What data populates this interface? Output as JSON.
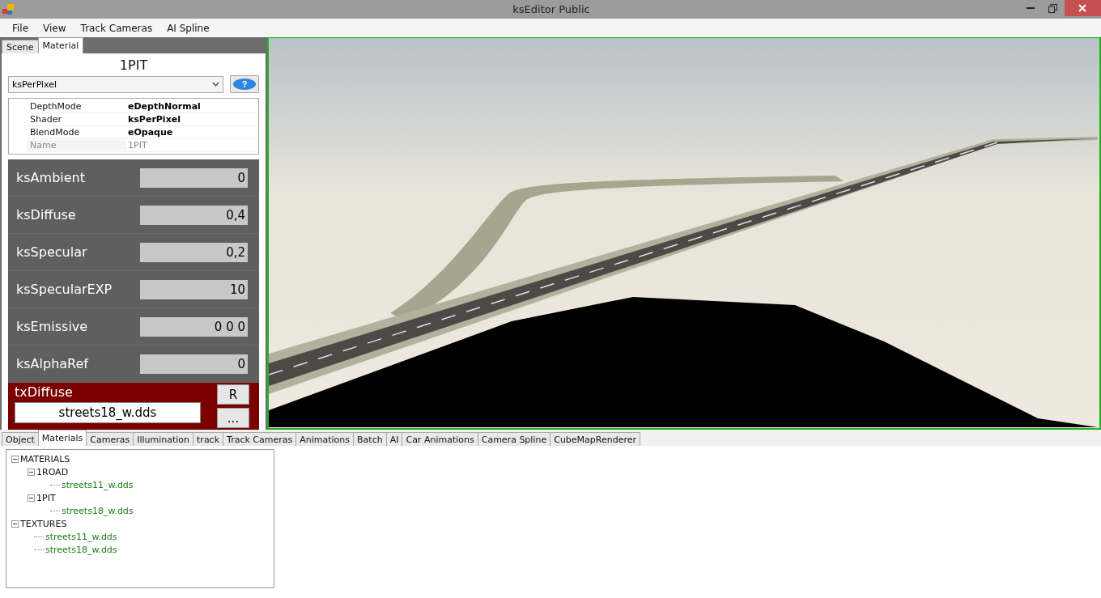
{
  "window": {
    "title": "ksEditor Public"
  },
  "menu": [
    "File",
    "View",
    "Track Cameras",
    "AI Spline"
  ],
  "top_tabs": [
    {
      "label": "Scene",
      "selected": false
    },
    {
      "label": "Material",
      "selected": true
    }
  ],
  "material": {
    "name": "1PIT",
    "shader_select": "ksPerPixel",
    "help_button": "?",
    "properties": [
      {
        "key": "DepthMode",
        "value": "eDepthNormal",
        "disabled": false
      },
      {
        "key": "Shader",
        "value": "ksPerPixel",
        "disabled": false
      },
      {
        "key": "BlendMode",
        "value": "eOpaque",
        "disabled": false
      },
      {
        "key": "Name",
        "value": "1PIT",
        "disabled": true
      }
    ],
    "parameters": [
      {
        "name": "ksAmbient",
        "value": "0"
      },
      {
        "name": "ksDiffuse",
        "value": "0,4"
      },
      {
        "name": "ksSpecular",
        "value": "0,2"
      },
      {
        "name": "ksSpecularEXP",
        "value": "10"
      },
      {
        "name": "ksEmissive",
        "value": "0 0 0"
      },
      {
        "name": "ksAlphaRef",
        "value": "0"
      }
    ],
    "texture": {
      "slot": "txDiffuse",
      "file": "streets18_w.dds",
      "buttons": [
        "R",
        "..."
      ]
    }
  },
  "bottom_tabs": [
    {
      "label": "Object",
      "selected": false
    },
    {
      "label": "Materials",
      "selected": true
    },
    {
      "label": "Cameras",
      "selected": false
    },
    {
      "label": "Illumination",
      "selected": false
    },
    {
      "label": "track",
      "selected": false
    },
    {
      "label": "Track Cameras",
      "selected": false
    },
    {
      "label": "Animations",
      "selected": false
    },
    {
      "label": "Batch",
      "selected": false
    },
    {
      "label": "AI",
      "selected": false
    },
    {
      "label": "Car Animations",
      "selected": false
    },
    {
      "label": "Camera Spline",
      "selected": false
    },
    {
      "label": "CubeMapRenderer",
      "selected": false
    }
  ],
  "tree": [
    {
      "label": "MATERIALS",
      "expanded": true,
      "children": [
        {
          "label": "1ROAD",
          "expanded": true,
          "children": [
            {
              "label": "streets11_w.dds"
            }
          ]
        },
        {
          "label": "1PIT",
          "expanded": true,
          "children": [
            {
              "label": "streets18_w.dds"
            }
          ]
        }
      ]
    },
    {
      "label": "TEXTURES",
      "expanded": true,
      "children": [
        {
          "label": "streets11_w.dds"
        },
        {
          "label": "streets18_w.dds"
        }
      ]
    }
  ]
}
